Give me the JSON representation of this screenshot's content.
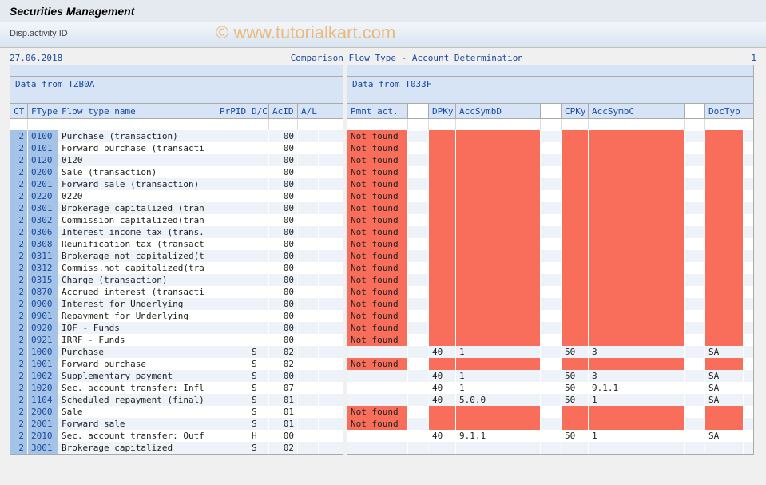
{
  "header": {
    "title": "Securities Management"
  },
  "toolbar": {
    "disp_label": "Disp.activity ID"
  },
  "report": {
    "date": "27.06.2018",
    "title": "Comparison Flow Type - Account Determination",
    "page": "1"
  },
  "left": {
    "section_title": "Data from TZB0A",
    "cols": {
      "ct": "CT",
      "ftype": "FType",
      "name": "Flow type name",
      "prpid": "PrPID",
      "dc": "D/C",
      "acid": "AcID",
      "al": "A/L"
    }
  },
  "right": {
    "section_title": "Data from T033F",
    "cols": {
      "pmnt": "Pmnt act.",
      "dpky": "DPKy",
      "accd": "AccSymbD",
      "cpky": "CPKy",
      "accc": "AccSymbC",
      "doc": "DocTyp"
    }
  },
  "rows": [
    {
      "ct": "2",
      "ftype": "0100",
      "name": "Purchase (transaction)",
      "prpid": "",
      "dc": "",
      "acid": "00",
      "al": "",
      "nf": true,
      "dpky": "",
      "accd": "",
      "cpky": "",
      "accc": "",
      "doc": "",
      "err": true
    },
    {
      "ct": "2",
      "ftype": "0101",
      "name": "Forward purchase (transacti",
      "prpid": "",
      "dc": "",
      "acid": "00",
      "al": "",
      "nf": true,
      "dpky": "",
      "accd": "",
      "cpky": "",
      "accc": "",
      "doc": "",
      "err": true
    },
    {
      "ct": "2",
      "ftype": "0120",
      "name": "0120",
      "prpid": "",
      "dc": "",
      "acid": "00",
      "al": "",
      "nf": true,
      "dpky": "",
      "accd": "",
      "cpky": "",
      "accc": "",
      "doc": "",
      "err": true
    },
    {
      "ct": "2",
      "ftype": "0200",
      "name": "Sale (transaction)",
      "prpid": "",
      "dc": "",
      "acid": "00",
      "al": "",
      "nf": true,
      "dpky": "",
      "accd": "",
      "cpky": "",
      "accc": "",
      "doc": "",
      "err": true
    },
    {
      "ct": "2",
      "ftype": "0201",
      "name": "Forward sale (transaction)",
      "prpid": "",
      "dc": "",
      "acid": "00",
      "al": "",
      "nf": true,
      "dpky": "",
      "accd": "",
      "cpky": "",
      "accc": "",
      "doc": "",
      "err": true
    },
    {
      "ct": "2",
      "ftype": "0220",
      "name": "0220",
      "prpid": "",
      "dc": "",
      "acid": "00",
      "al": "",
      "nf": true,
      "dpky": "",
      "accd": "",
      "cpky": "",
      "accc": "",
      "doc": "",
      "err": true
    },
    {
      "ct": "2",
      "ftype": "0301",
      "name": "Brokerage capitalized (tran",
      "prpid": "",
      "dc": "",
      "acid": "00",
      "al": "",
      "nf": true,
      "dpky": "",
      "accd": "",
      "cpky": "",
      "accc": "",
      "doc": "",
      "err": true
    },
    {
      "ct": "2",
      "ftype": "0302",
      "name": "Commission capitalized(tran",
      "prpid": "",
      "dc": "",
      "acid": "00",
      "al": "",
      "nf": true,
      "dpky": "",
      "accd": "",
      "cpky": "",
      "accc": "",
      "doc": "",
      "err": true
    },
    {
      "ct": "2",
      "ftype": "0306",
      "name": "Interest income tax (trans.",
      "prpid": "",
      "dc": "",
      "acid": "00",
      "al": "",
      "nf": true,
      "dpky": "",
      "accd": "",
      "cpky": "",
      "accc": "",
      "doc": "",
      "err": true
    },
    {
      "ct": "2",
      "ftype": "0308",
      "name": "Reunification tax (transact",
      "prpid": "",
      "dc": "",
      "acid": "00",
      "al": "",
      "nf": true,
      "dpky": "",
      "accd": "",
      "cpky": "",
      "accc": "",
      "doc": "",
      "err": true
    },
    {
      "ct": "2",
      "ftype": "0311",
      "name": "Brokerage not capitalized(t",
      "prpid": "",
      "dc": "",
      "acid": "00",
      "al": "",
      "nf": true,
      "dpky": "",
      "accd": "",
      "cpky": "",
      "accc": "",
      "doc": "",
      "err": true
    },
    {
      "ct": "2",
      "ftype": "0312",
      "name": "Commiss.not capitalized(tra",
      "prpid": "",
      "dc": "",
      "acid": "00",
      "al": "",
      "nf": true,
      "dpky": "",
      "accd": "",
      "cpky": "",
      "accc": "",
      "doc": "",
      "err": true
    },
    {
      "ct": "2",
      "ftype": "0315",
      "name": "Charge (transaction)",
      "prpid": "",
      "dc": "",
      "acid": "00",
      "al": "",
      "nf": true,
      "dpky": "",
      "accd": "",
      "cpky": "",
      "accc": "",
      "doc": "",
      "err": true
    },
    {
      "ct": "2",
      "ftype": "0870",
      "name": "Accrued interest (transacti",
      "prpid": "",
      "dc": "",
      "acid": "00",
      "al": "",
      "nf": true,
      "dpky": "",
      "accd": "",
      "cpky": "",
      "accc": "",
      "doc": "",
      "err": true
    },
    {
      "ct": "2",
      "ftype": "0900",
      "name": "Interest for Underlying",
      "prpid": "",
      "dc": "",
      "acid": "00",
      "al": "",
      "nf": true,
      "dpky": "",
      "accd": "",
      "cpky": "",
      "accc": "",
      "doc": "",
      "err": true
    },
    {
      "ct": "2",
      "ftype": "0901",
      "name": "Repayment for Underlying",
      "prpid": "",
      "dc": "",
      "acid": "00",
      "al": "",
      "nf": true,
      "dpky": "",
      "accd": "",
      "cpky": "",
      "accc": "",
      "doc": "",
      "err": true
    },
    {
      "ct": "2",
      "ftype": "0920",
      "name": "IOF - Funds",
      "prpid": "",
      "dc": "",
      "acid": "00",
      "al": "",
      "nf": true,
      "dpky": "",
      "accd": "",
      "cpky": "",
      "accc": "",
      "doc": "",
      "err": true
    },
    {
      "ct": "2",
      "ftype": "0921",
      "name": "IRRF - Funds",
      "prpid": "",
      "dc": "",
      "acid": "00",
      "al": "",
      "nf": true,
      "dpky": "",
      "accd": "",
      "cpky": "",
      "accc": "",
      "doc": "",
      "err": true
    },
    {
      "ct": "2",
      "ftype": "1000",
      "name": "Purchase",
      "prpid": "",
      "dc": "S",
      "acid": "02",
      "al": "",
      "nf": false,
      "dpky": "40",
      "accd": "1",
      "cpky": "50",
      "accc": "3",
      "doc": "SA",
      "err": false
    },
    {
      "ct": "2",
      "ftype": "1001",
      "name": "Forward purchase",
      "prpid": "",
      "dc": "S",
      "acid": "02",
      "al": "",
      "nf": true,
      "dpky": "",
      "accd": "",
      "cpky": "",
      "accc": "",
      "doc": "",
      "err": true
    },
    {
      "ct": "2",
      "ftype": "1002",
      "name": "Supplementary payment",
      "prpid": "",
      "dc": "S",
      "acid": "00",
      "al": "",
      "nf": false,
      "dpky": "40",
      "accd": "1",
      "cpky": "50",
      "accc": "3",
      "doc": "SA",
      "err": false
    },
    {
      "ct": "2",
      "ftype": "1020",
      "name": "Sec. account transfer: Infl",
      "prpid": "",
      "dc": "S",
      "acid": "07",
      "al": "",
      "nf": false,
      "dpky": "40",
      "accd": "1",
      "cpky": "50",
      "accc": "9.1.1",
      "doc": "SA",
      "err": false
    },
    {
      "ct": "2",
      "ftype": "1104",
      "name": "Scheduled repayment (final)",
      "prpid": "",
      "dc": "S",
      "acid": "01",
      "al": "",
      "nf": false,
      "dpky": "40",
      "accd": "5.0.0",
      "cpky": "50",
      "accc": "1",
      "doc": "SA",
      "err": false
    },
    {
      "ct": "2",
      "ftype": "2000",
      "name": "Sale",
      "prpid": "",
      "dc": "S",
      "acid": "01",
      "al": "",
      "nf": true,
      "dpky": "",
      "accd": "",
      "cpky": "",
      "accc": "",
      "doc": "",
      "err": true
    },
    {
      "ct": "2",
      "ftype": "2001",
      "name": "Forward sale",
      "prpid": "",
      "dc": "S",
      "acid": "01",
      "al": "",
      "nf": true,
      "dpky": "",
      "accd": "",
      "cpky": "",
      "accc": "",
      "doc": "",
      "err": true
    },
    {
      "ct": "2",
      "ftype": "2010",
      "name": "Sec. account transfer: Outf",
      "prpid": "",
      "dc": "H",
      "acid": "00",
      "al": "",
      "nf": false,
      "dpky": "40",
      "accd": "9.1.1",
      "cpky": "50",
      "accc": "1",
      "doc": "SA",
      "err": false
    },
    {
      "ct": "2",
      "ftype": "3001",
      "name": "Brokerage capitalized",
      "prpid": "",
      "dc": "S",
      "acid": "02",
      "al": "",
      "nf": false,
      "dpky": "",
      "accd": "",
      "cpky": "",
      "accc": "",
      "doc": "",
      "err": false
    }
  ],
  "watermark": "© www.tutorialkart.com"
}
